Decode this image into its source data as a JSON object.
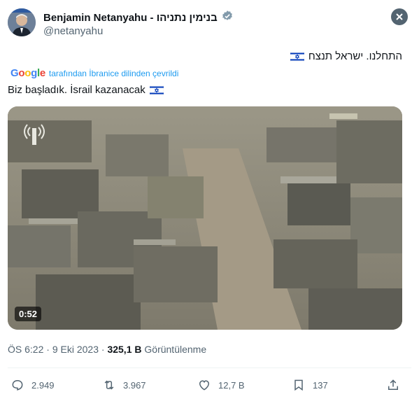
{
  "author": {
    "name": "Benjamin Netanyahu - בנימין נתניהו",
    "handle": "@netanyahu",
    "verified": true
  },
  "tweet": {
    "original_text": "התחלנו. ישראל תנצח",
    "translation_note": "tarafından İbranice dilinden çevrildi",
    "translation_provider": "Google",
    "translated_text": "Biz başladık. İsrail kazanacak"
  },
  "video": {
    "duration": "0:52"
  },
  "meta": {
    "time": "ÖS 6:22",
    "separator": "·",
    "date": "9 Eki 2023",
    "views": "325,1 B",
    "views_label": "Görüntülenme"
  },
  "actions": {
    "replies": "2.949",
    "reposts": "3.967",
    "likes": "12,7 B",
    "bookmarks": "137"
  },
  "colors": {
    "accent": "#1d9bf0",
    "muted_text": "#536471",
    "text": "#0f1419"
  }
}
